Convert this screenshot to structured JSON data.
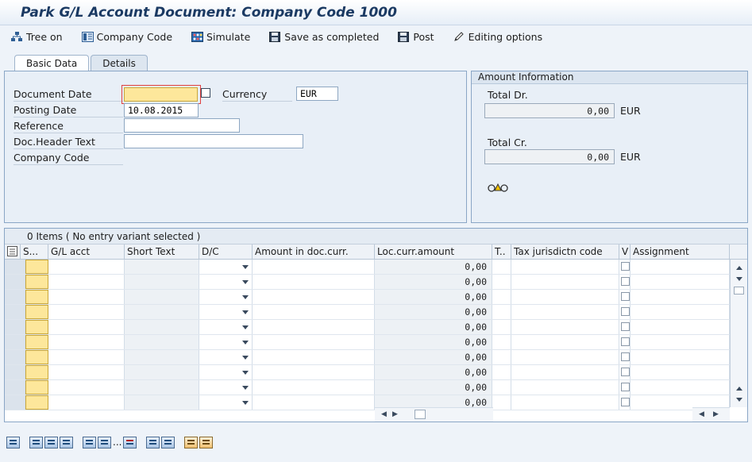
{
  "title": "Park G/L Account Document: Company Code 1000",
  "toolbar": {
    "tree_on": "Tree on",
    "company_code": "Company Code",
    "simulate": "Simulate",
    "save_completed": "Save as completed",
    "post": "Post",
    "editing_options": "Editing options"
  },
  "tabs": {
    "basic": "Basic Data",
    "details": "Details"
  },
  "basic": {
    "document_date_label": "Document Date",
    "document_date_value": "",
    "currency_label": "Currency",
    "currency_value": "EUR",
    "posting_date_label": "Posting Date",
    "posting_date_value": "10.08.2015",
    "reference_label": "Reference",
    "reference_value": "",
    "header_text_label": "Doc.Header Text",
    "header_text_value": "",
    "company_code_label": "Company Code"
  },
  "amount": {
    "header": "Amount Information",
    "total_dr_label": "Total Dr.",
    "total_dr_value": "0,00",
    "total_dr_currency": "EUR",
    "total_cr_label": "Total Cr.",
    "total_cr_value": "0,00",
    "total_cr_currency": "EUR"
  },
  "grid": {
    "caption": "0 Items ( No entry variant selected )",
    "columns": [
      "S...",
      "G/L acct",
      "Short Text",
      "D/C",
      "Amount in doc.curr.",
      "Loc.curr.amount",
      "T..",
      "Tax jurisdictn code",
      "V",
      "Assignment"
    ],
    "row_amount": "0,00"
  },
  "colors": {
    "title": "#1b3a63",
    "required": "#fde79b",
    "panel": "#e8eff7"
  }
}
